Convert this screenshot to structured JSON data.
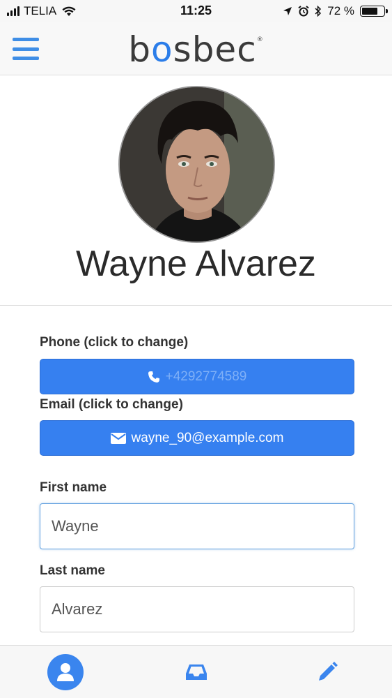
{
  "status_bar": {
    "carrier": "TELIA",
    "time": "11:25",
    "battery_percent": "72 %",
    "battery_level": 0.72
  },
  "header": {
    "logo_text_parts": [
      "b",
      "o",
      "sbec"
    ],
    "logo_mark": "®",
    "menu_icon": "hamburger-icon"
  },
  "profile": {
    "name": "Wayne Alvarez"
  },
  "form": {
    "phone_label": "Phone (click to change)",
    "phone_value": "+4292774589",
    "phone_icon": "phone-icon",
    "email_label": "Email (click to change)",
    "email_value": "wayne_90@example.com",
    "email_icon": "envelope-icon",
    "first_name_label": "First name",
    "first_name_value": "Wayne",
    "last_name_label": "Last name",
    "last_name_value": "Alvarez"
  },
  "bottom_nav": {
    "items": [
      {
        "icon": "user-icon",
        "active": true
      },
      {
        "icon": "inbox-icon",
        "active": false
      },
      {
        "icon": "pencil-icon",
        "active": false
      }
    ]
  },
  "colors": {
    "accent": "#3680f0",
    "nav_icon": "#3a85ee"
  }
}
